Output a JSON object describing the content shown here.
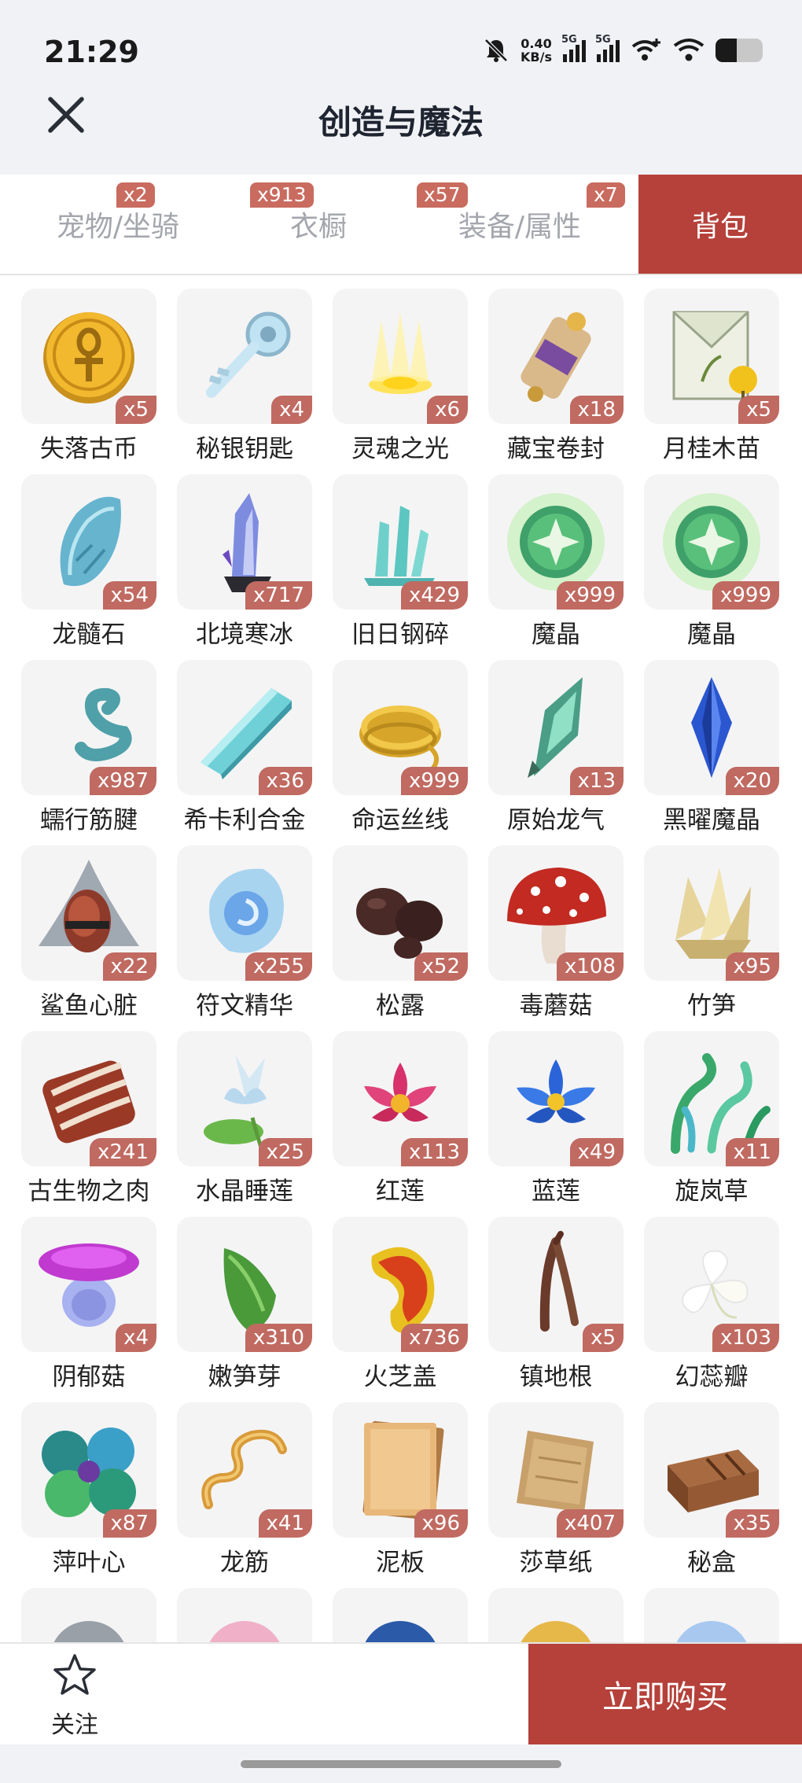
{
  "status": {
    "time": "21:29",
    "speed_value": "0.40",
    "speed_unit": "KB/s",
    "sim1": "5G",
    "sim2": "5G",
    "battery_level": 0.45
  },
  "header": {
    "title": "创造与魔法",
    "close_icon": "close-icon"
  },
  "tabs": [
    {
      "label": "宠物/坐骑",
      "badge": "x2",
      "active": false
    },
    {
      "label": "衣橱",
      "badge": "x913",
      "active": false
    },
    {
      "label": "装备/属性",
      "badge": "x57",
      "active": false
    },
    {
      "label": "背包",
      "badge": "",
      "active": true
    }
  ],
  "items": [
    {
      "name": "失落古币",
      "count": "x5",
      "icon": "coin-icon"
    },
    {
      "name": "秘银钥匙",
      "count": "x4",
      "icon": "key-icon"
    },
    {
      "name": "灵魂之光",
      "count": "x6",
      "icon": "soul-light-icon"
    },
    {
      "name": "藏宝卷封",
      "count": "x18",
      "icon": "scroll-icon"
    },
    {
      "name": "月桂木苗",
      "count": "x5",
      "icon": "seed-pack-icon"
    },
    {
      "name": "龙髓石",
      "count": "x54",
      "icon": "dragon-stone-icon"
    },
    {
      "name": "北境寒冰",
      "count": "x717",
      "icon": "ice-crystal-icon"
    },
    {
      "name": "旧日钢碎",
      "count": "x429",
      "icon": "steel-shards-icon"
    },
    {
      "name": "魔晶",
      "count": "x999",
      "icon": "magic-orb-icon"
    },
    {
      "name": "魔晶",
      "count": "x999",
      "icon": "magic-orb-icon"
    },
    {
      "name": "蠕行筋腱",
      "count": "x987",
      "icon": "tendon-icon"
    },
    {
      "name": "希卡利合金",
      "count": "x36",
      "icon": "alloy-bar-icon"
    },
    {
      "name": "命运丝线",
      "count": "x999",
      "icon": "thread-icon"
    },
    {
      "name": "原始龙气",
      "count": "x13",
      "icon": "dragon-breath-crystal-icon"
    },
    {
      "name": "黑曜魔晶",
      "count": "x20",
      "icon": "obsidian-crystal-icon"
    },
    {
      "name": "鲨鱼心脏",
      "count": "x22",
      "icon": "shark-heart-icon"
    },
    {
      "name": "符文精华",
      "count": "x255",
      "icon": "rune-essence-icon"
    },
    {
      "name": "松露",
      "count": "x52",
      "icon": "truffle-icon"
    },
    {
      "name": "毒蘑菇",
      "count": "x108",
      "icon": "toadstool-icon"
    },
    {
      "name": "竹笋",
      "count": "x95",
      "icon": "bamboo-shoot-icon"
    },
    {
      "name": "古生物之肉",
      "count": "x241",
      "icon": "meat-icon"
    },
    {
      "name": "水晶睡莲",
      "count": "x25",
      "icon": "crystal-lotus-icon"
    },
    {
      "name": "红莲",
      "count": "x113",
      "icon": "red-lotus-icon"
    },
    {
      "name": "蓝莲",
      "count": "x49",
      "icon": "blue-lotus-icon"
    },
    {
      "name": "旋岚草",
      "count": "x11",
      "icon": "swirl-grass-icon"
    },
    {
      "name": "阴郁菇",
      "count": "x4",
      "icon": "gloom-mushroom-icon"
    },
    {
      "name": "嫩笋芽",
      "count": "x310",
      "icon": "sprout-icon"
    },
    {
      "name": "火芝盖",
      "count": "x736",
      "icon": "fire-fungus-icon"
    },
    {
      "name": "镇地根",
      "count": "x5",
      "icon": "root-icon"
    },
    {
      "name": "幻蕊瓣",
      "count": "x103",
      "icon": "petal-icon"
    },
    {
      "name": "萍叶心",
      "count": "x87",
      "icon": "clover-icon"
    },
    {
      "name": "龙筋",
      "count": "x41",
      "icon": "dragon-sinew-icon"
    },
    {
      "name": "泥板",
      "count": "x96",
      "icon": "clay-tablet-icon"
    },
    {
      "name": "莎草纸",
      "count": "x407",
      "icon": "papyrus-icon"
    },
    {
      "name": "秘盒",
      "count": "x35",
      "icon": "wooden-box-icon"
    }
  ],
  "bottom": {
    "follow_label": "关注",
    "buy_label": "立即购买"
  },
  "colors": {
    "accent": "#b5413a",
    "badge": "#c06a61",
    "tile": "#f4f4f5"
  }
}
